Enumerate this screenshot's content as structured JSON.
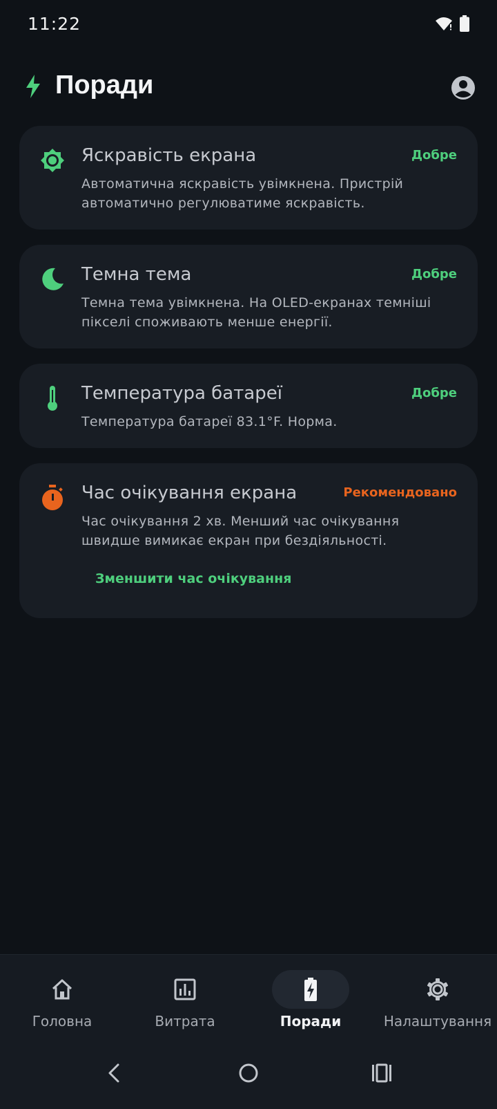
{
  "status": {
    "time": "11:22"
  },
  "header": {
    "title": "Поради"
  },
  "cards": [
    {
      "title": "Яскравість екрана",
      "status": "Добре",
      "description": "Автоматична яскравість увімкнена. Пристрій автоматично регулюватиме яскравість.",
      "icon": "brightness-icon"
    },
    {
      "title": "Темна тема",
      "status": "Добре",
      "description": "Темна тема увімкнена. На OLED-екранах темніші пікселі споживають менше енергії.",
      "icon": "moon-icon"
    },
    {
      "title": "Температура батареї",
      "status": "Добре",
      "description": "Температура батареї 83.1°F. Норма.",
      "icon": "thermometer-icon"
    },
    {
      "title": "Час очікування екрана",
      "status": "Рекомендовано",
      "description": "Час очікування 2 хв. Менший час очікування швидше вимикає екран при бездіяльності.",
      "action": "Зменшити час очікування",
      "icon": "timer-icon"
    }
  ],
  "nav": {
    "items": [
      {
        "label": "Головна",
        "icon": "home-icon"
      },
      {
        "label": "Витрата",
        "icon": "bar-chart-icon"
      },
      {
        "label": "Поради",
        "icon": "battery-charging-icon"
      },
      {
        "label": "Налаштування",
        "icon": "gear-icon"
      }
    ],
    "active_index": 2
  },
  "colors": {
    "accent_green": "#4ecf7d",
    "warning_orange": "#e8641e",
    "background": "#0e1217",
    "card": "#181d24"
  }
}
